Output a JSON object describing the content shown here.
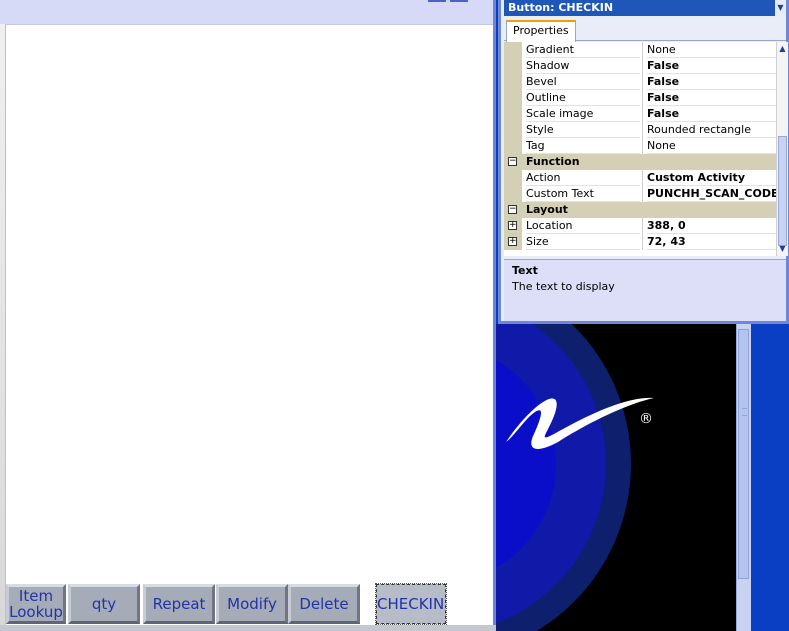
{
  "object_selector": {
    "label": "Button: CHECKIN",
    "icon": "chevron-down-icon"
  },
  "tabs": [
    {
      "label": "Properties"
    }
  ],
  "properties": {
    "rows": [
      {
        "name": "Gradient",
        "value": "None",
        "bold": false
      },
      {
        "name": "Shadow",
        "value": "False",
        "bold": true
      },
      {
        "name": "Bevel",
        "value": "False",
        "bold": true
      },
      {
        "name": "Outline",
        "value": "False",
        "bold": true
      },
      {
        "name": "Scale image",
        "value": "False",
        "bold": true
      },
      {
        "name": "Style",
        "value": "Rounded rectangle",
        "bold": false
      },
      {
        "name": "Tag",
        "value": "None",
        "bold": false
      }
    ],
    "function_category": "Function",
    "function_rows": [
      {
        "name": "Action",
        "value": "Custom Activity",
        "bold": true
      },
      {
        "name": "Custom Text",
        "value": "PUNCHH_SCAN_CODE",
        "bold": true
      }
    ],
    "layout_category": "Layout",
    "layout_rows": [
      {
        "name": "Location",
        "value": "388, 0",
        "bold": true
      },
      {
        "name": "Size",
        "value": "72, 43",
        "bold": true
      }
    ]
  },
  "description": {
    "title": "Text",
    "text": "The text to display"
  },
  "pos_buttons": [
    {
      "label": "Item Lookup"
    },
    {
      "label": "qty"
    },
    {
      "label": "Repeat"
    },
    {
      "label": "Modify"
    },
    {
      "label": "Delete"
    },
    {
      "label": "CHECKIN",
      "selected": true
    }
  ],
  "logo": {
    "mark": "®"
  },
  "colors": {
    "panel_title_bar": "#1f57b8",
    "category_row": "#d4d0b6",
    "button_text": "#2233a8",
    "background_blue": "#0a3fc4"
  }
}
